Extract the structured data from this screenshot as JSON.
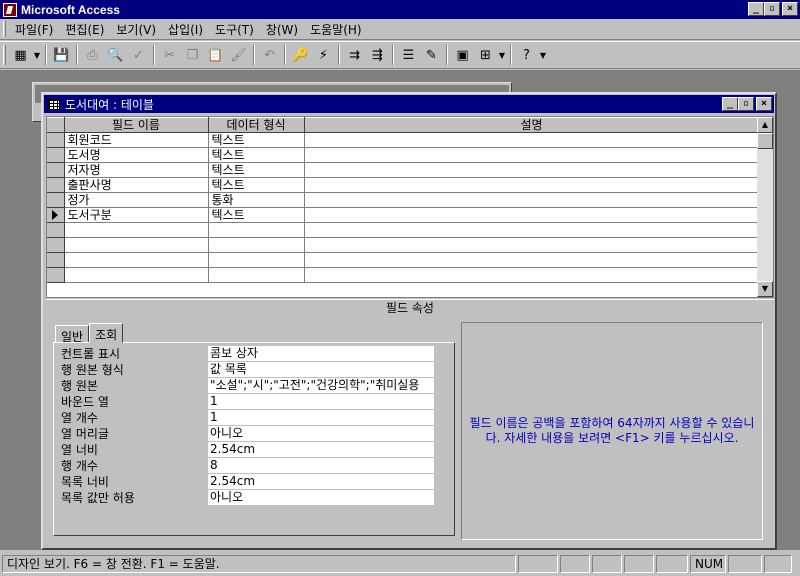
{
  "app": {
    "title": "Microsoft Access",
    "title_buttons": [
      "_",
      "▫",
      "×"
    ]
  },
  "menu": [
    "파일(F)",
    "편집(E)",
    "보기(V)",
    "삽입(I)",
    "도구(T)",
    "창(W)",
    "도움말(H)"
  ],
  "toolbar": {
    "icons": [
      "view-icon",
      "save-icon",
      "print-icon",
      "print-preview-icon",
      "spelling-icon",
      "cut-icon",
      "copy-icon",
      "paste-icon",
      "format-painter-icon",
      "undo-icon",
      "primary-key-icon",
      "indexes-icon",
      "insert-rows-icon",
      "delete-rows-icon",
      "properties-icon",
      "build-icon",
      "database-window-icon",
      "new-object-icon",
      "help-icon"
    ]
  },
  "table_window": {
    "title": "도서대여 : 테이블",
    "columns": [
      "필드 이름",
      "데이터 형식",
      "설명"
    ],
    "rows": [
      {
        "field": "회원코드",
        "type": "텍스트",
        "desc": ""
      },
      {
        "field": "도서명",
        "type": "텍스트",
        "desc": ""
      },
      {
        "field": "저자명",
        "type": "텍스트",
        "desc": ""
      },
      {
        "field": "출판사명",
        "type": "텍스트",
        "desc": ""
      },
      {
        "field": "정가",
        "type": "통화",
        "desc": ""
      },
      {
        "field": "도서구분",
        "type": "텍스트",
        "desc": ""
      },
      {
        "field": "",
        "type": "",
        "desc": ""
      },
      {
        "field": "",
        "type": "",
        "desc": ""
      },
      {
        "field": "",
        "type": "",
        "desc": ""
      },
      {
        "field": "",
        "type": "",
        "desc": ""
      }
    ],
    "selected_row_index": 5,
    "field_properties_label": "필드 속성",
    "tabs": [
      "일반",
      "조회"
    ],
    "active_tab": "조회",
    "properties": [
      {
        "label": "컨트롤 표시",
        "value": "콤보 상자"
      },
      {
        "label": "행 원본 형식",
        "value": "값 목록"
      },
      {
        "label": "행 원본",
        "value": "\"소설\";\"시\";\"고전\";\"건강의학\";\"취미실용"
      },
      {
        "label": "바운드 열",
        "value": "1"
      },
      {
        "label": "열 개수",
        "value": "1"
      },
      {
        "label": "열 머리글",
        "value": "아니오"
      },
      {
        "label": "열 너비",
        "value": "2.54cm"
      },
      {
        "label": "행 개수",
        "value": "8"
      },
      {
        "label": "목록 너비",
        "value": "2.54cm"
      },
      {
        "label": "목록 값만 허용",
        "value": "아니오"
      }
    ],
    "help_text": "필드 이름은 공백을 포함하여 64자까지 사용할 수 있습니다. 자세한 내용을 보려면 <F1> 키를 누르십시오."
  },
  "status": {
    "text": "디자인 보기.  F6 = 창 전환.  F1 = 도움말.",
    "num": "NUM"
  }
}
